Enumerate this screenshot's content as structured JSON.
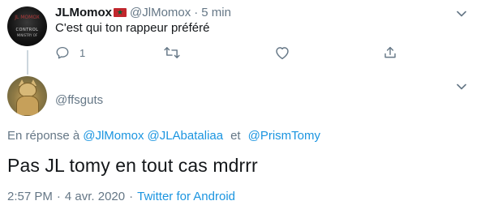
{
  "parent_tweet": {
    "display_name": "JLMomox",
    "handle": "@JlMomox",
    "separator": "·",
    "time": "5 min",
    "text": "C'est qui ton rappeur préféré",
    "avatar_lines": [
      "JL MOMOX",
      "CONTROL",
      "MINISTRY OF"
    ],
    "actions": {
      "reply_count": "1",
      "retweet_count": "",
      "like_count": ""
    }
  },
  "reply_tweet": {
    "handle": "@ffsguts",
    "replying_label": "En réponse à",
    "mentions": [
      "@JlMomox",
      "@JLAbataliaa",
      "@PrismTomy"
    ],
    "conjunction": "et",
    "text": "Pas JL tomy en tout cas mdrrr",
    "time": "2:57 PM",
    "separator": "·",
    "date": "4 avr. 2020",
    "source": "Twitter for Android"
  },
  "colors": {
    "text": "#14171a",
    "secondary": "#657786",
    "link": "#1b95e0",
    "line": "#ccd6dd"
  }
}
